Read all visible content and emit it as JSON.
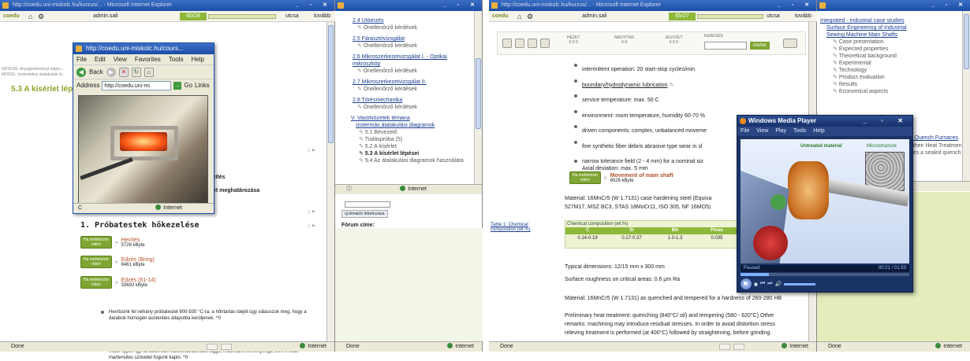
{
  "left": {
    "title": "http://coedu.uni-miskolc.hu/kurzus/... - Microsoft Internet Explorer",
    "toolbar": {
      "brand": "coedu",
      "user": "admin.sali",
      "progress": "60/28",
      "sort": "utcsa",
      "action": "tovább"
    },
    "breadcrumb1": "NÉVEDE: Anyagtudományi alapis...",
    "breadcrumb2": "MODUL: Izotermikus átalakulási di...",
    "heading": "5.3 A kísérlet lépései",
    "frag1": "zítés",
    "frag2": "et meghatározása",
    "section_title": "1. Próbatestek hőkezelése",
    "media": [
      {
        "badge": "Ha mehetvizio",
        "badge2": "videó",
        "title": "Hevítés",
        "size": "5726 kByte"
      },
      {
        "badge": "Ha mehetvizio",
        "badge2": "videó",
        "title": "Edzés (Bring)",
        "size": "8461 kByte"
      },
      {
        "badge": "Ha mehetvizio",
        "badge2": "videó",
        "title": "Edzés (61-14)",
        "size": "33692 kByte"
      }
    ],
    "para1": "Hevítsünk fel néhány próbatestet 900-930 °C-ra, a hőntartás idejét úgy válasszuk meg, hogy a darabok homogén austenites állapotba kerüljenek. ^0",
    "para2": "Az első próbatestet az austenites állapotból közvetlenül feadjuk - vagyis a kemencéből rögtön a vízbe ejtjük. Így az adott acél karbontartalmától függő, maximális keménységű, 100%-osan martensites szövetet fogunk kapni. ^0",
    "status": "Done",
    "zone": "Internet"
  },
  "popup": {
    "title": "http://coedu.uni-miskolc.hu/cours...",
    "menu": [
      "File",
      "Edit",
      "View",
      "Favorites",
      "Tools",
      "Help"
    ],
    "back": "Back",
    "address_label": "Address",
    "address": "http://coedu.uni-mi",
    "go": "Go",
    "links": "Links",
    "zone": "Internet",
    "status": "C"
  },
  "toc": {
    "items": [
      {
        "t": "2.4 Utóérzés",
        "s": "Önellenőrző kérdések"
      },
      {
        "t": "2.5 Fárasztóvizsgálat",
        "s": "Önellenőrző kérdések"
      },
      {
        "t": "2.6 Mikroszerkezetvizsgálat I. - Optikai mikroszkóp",
        "s": "Önellenőrző kérdések"
      },
      {
        "t": "2.7 Mikroszerkezetvizsgálat II.",
        "s": "Önellenőrző kérdések"
      },
      {
        "t": "2.8 Törésmechanika",
        "s": "Önellenőrző kérdések"
      }
    ],
    "chapter": "V. Vasötvözetek témana",
    "chapter_sub": "Izotermás átalakulási diagramok",
    "subs": [
      "5.1 Bevezető",
      "Tudáspróba (5)",
      "5.2 A kísérlet",
      "5.3 A kísérlet lépései",
      "5.4 Az átalakulási diagramok használata"
    ],
    "zone": "Internet",
    "forum_btn": "új témakör létrehozása",
    "forum_label": "Fórum címe:",
    "status": "Done"
  },
  "right": {
    "title": "http://coedu.uni-miskolc.hu/kurzus/... - Microsoft Internet Explorer",
    "toolbar": {
      "brand": "coedu",
      "user": "admin.sali",
      "progress": "65/27",
      "sort": "utcsa",
      "action": "tovább"
    },
    "tools": [
      {
        "l": "HÉZET",
        "v": "0 0 0"
      },
      {
        "l": "NAGYITÁS",
        "v": "0 0"
      },
      {
        "l": "JEGYZET",
        "v": "0 0 0"
      }
    ],
    "search_label": "KERESÉS",
    "search_btn": "mehet",
    "bullets": [
      "intermittent operation: 20 start-stop cycles/min",
      "boundary/hydrodynamic lubrication",
      "service temperature: max. 50 C",
      "environment: room temperature, humidity 60-70 %",
      "driven components: complex, unbalanced moveme",
      "fine synthetic fiber debris abrasive type wear in sl",
      "narrow tolerance field (2 - 4 mm) for a nominal siz"
    ],
    "axial": "Axial deviation: max. 5 mm",
    "media_title": "Movement of main shaft",
    "media_size": "8026 kByte",
    "material1": "Material: 16MnCr5 (W 1.7131) case hardening steel (Equiva",
    "material1b": "527M17, MSZ BC3, STAS 18MoCr11, ISO 305, NF 16MO5)",
    "table_caption": "Table 1: Chemical composition (wt.%)",
    "table_title": "Chemical composition (wt.%)",
    "table_heads": [
      "C",
      "Si",
      "Mn",
      "Pmax"
    ],
    "table_vals": [
      "0.14-0.19",
      "0.17-0.37",
      "1.0-1.3",
      "0.035"
    ],
    "dimensions": "Typical dimensions: 12/15 mm x 300 mm",
    "roughness": "Surface roughness on critical areas: 0.6 µm Ra",
    "material2": "Material: 16MnCr5 (W 1.7131) as quenched and tempered for a hardness of 260-280 HB",
    "preheat1": "Preliminary heat treatment: quenching (840°C/ oil) and tempering (580 - 620°C) Other",
    "preheat2": "remarks: machining may introduce residual stresses. In order to avoid distortion stress",
    "preheat3": "releving treatment is performed (at 400°C) followed by straightening, before grinding.",
    "status": "Done",
    "zone": "Internet"
  },
  "wmp": {
    "title": "Windows Media Player",
    "menu": [
      "File",
      "View",
      "Play",
      "Tools",
      "Help"
    ],
    "label1": "Untreated material",
    "label2": "Microstructure",
    "state": "Paused",
    "time": "00:21 / 01:53",
    "progress": 0.17
  },
  "rtoc": {
    "title": "Integrated - industrial case studies",
    "sub": "Surface Engineering of Industrial Sewing Machine Main Shafts",
    "items": [
      "Case presentation",
      "Expected properties",
      "Theoretical background",
      "Experimental",
      "Technology",
      "Product evaluation",
      "Results",
      "Economical aspects"
    ],
    "frag1": "al Quench Furnaces",
    "frag2": "their Heat Treatment",
    "frag3": "es a sealed quench",
    "zone": "Internet",
    "status": "Done"
  }
}
